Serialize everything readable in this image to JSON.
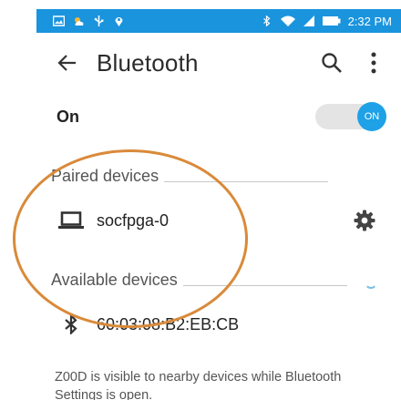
{
  "status_bar": {
    "time": "2:32 PM",
    "left_icons": [
      "image-icon",
      "weather-icon",
      "usb-icon",
      "location-icon"
    ],
    "right_icons": [
      "bluetooth-icon",
      "wifi-icon",
      "signal-icon",
      "battery-icon"
    ]
  },
  "toolbar": {
    "title": "Bluetooth",
    "back_icon": "arrow-left-icon",
    "search_icon": "search-icon",
    "menu_icon": "more-vert-icon"
  },
  "bluetooth_switch": {
    "label": "On",
    "state_label": "ON",
    "enabled": true
  },
  "paired": {
    "header": "Paired devices",
    "devices": [
      {
        "name": "socfpga-0",
        "icon": "laptop-icon",
        "settings_icon": "gear-icon"
      }
    ]
  },
  "available": {
    "header": "Available devices",
    "scanning": true,
    "devices": [
      {
        "name": "60:03:08:B2:EB:CB",
        "icon": "bluetooth-icon"
      }
    ]
  },
  "footer": {
    "visibility_text": "Z00D is visible to nearby devices while Bluetooth Settings is open."
  },
  "colors": {
    "status_bar": "#1a94dd",
    "accent": "#1ea1e6",
    "annotation": "#d98a3a"
  }
}
